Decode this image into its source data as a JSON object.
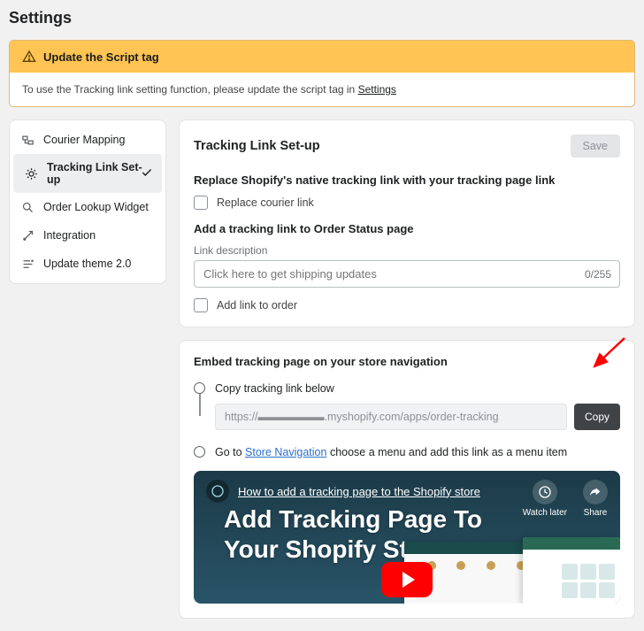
{
  "pageTitle": "Settings",
  "alert": {
    "title": "Update the Script tag",
    "body_prefix": "To use the Tracking link setting function, please update the script tag in ",
    "body_link": "Settings"
  },
  "sidebar": {
    "items": [
      {
        "label": "Courier Mapping"
      },
      {
        "label": "Tracking Link Set-up"
      },
      {
        "label": "Order Lookup Widget"
      },
      {
        "label": "Integration"
      },
      {
        "label": "Update theme 2.0"
      }
    ]
  },
  "card": {
    "title": "Tracking Link Set-up",
    "save": "Save",
    "replace_h": "Replace Shopify's native tracking link with your tracking page link",
    "replace_cb": "Replace courier link",
    "addlink_h": "Add a tracking link to Order Status page",
    "desc_label": "Link description",
    "desc_placeholder": "Click here to get shipping updates",
    "counter": "0/255",
    "addlink_cb": "Add link to order"
  },
  "embed": {
    "title": "Embed tracking page on your store navigation",
    "step1": "Copy tracking link below",
    "url": "https://▬▬▬▬▬▬.myshopify.com/apps/order-tracking",
    "copy": "Copy",
    "step2_pre": "Go to ",
    "step2_link": "Store Navigation",
    "step2_post": " choose a menu and add this link as a menu item"
  },
  "video": {
    "small_title": "How to add a tracking page to the Shopify store",
    "big_title_l1": "Add Tracking Page To",
    "big_title_l2": "Your Shopify Store",
    "watch": "Watch later",
    "share": "Share"
  }
}
